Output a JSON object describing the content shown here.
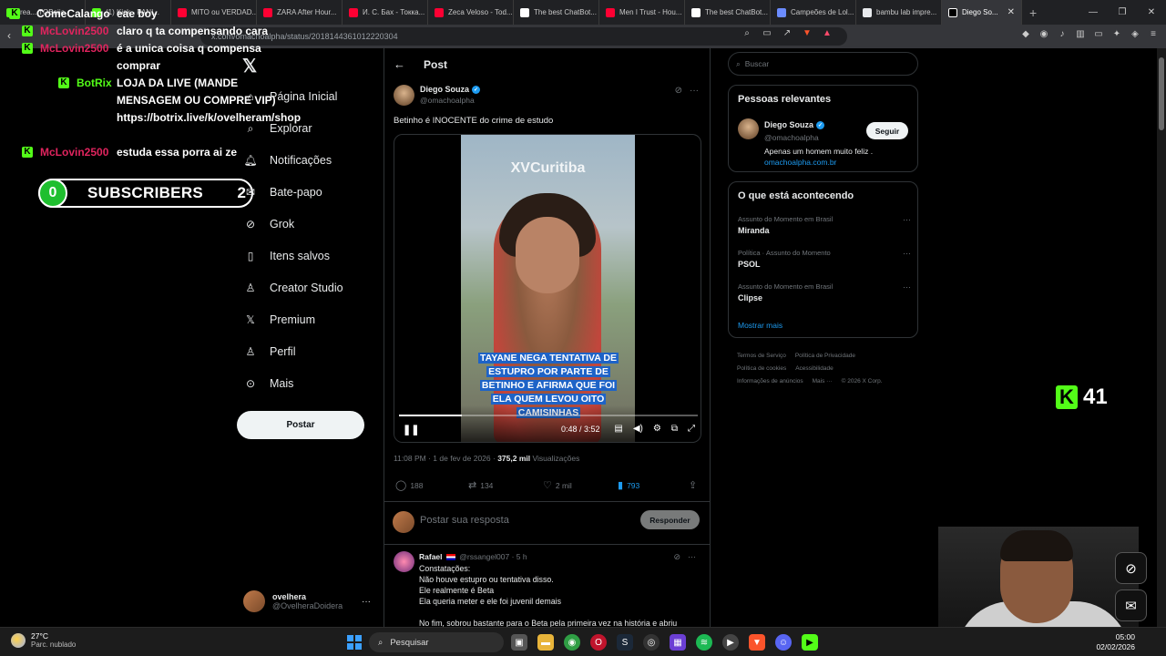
{
  "browser": {
    "tabs": [
      {
        "label": "rea... TOBeija",
        "color": "#53fc18"
      },
      {
        "label": "(1) Kick - PANI...",
        "color": "#53fc18"
      },
      {
        "label": "MITO ou VERDAD...",
        "color": "#ff0033"
      },
      {
        "label": "ZARA After Hour...",
        "color": "#ff0033"
      },
      {
        "label": "И. С. Бах - Токка...",
        "color": "#ff0033"
      },
      {
        "label": "Zeca Veloso - Tod...",
        "color": "#ff0033"
      },
      {
        "label": "The best ChatBot...",
        "color": "#ffffff"
      },
      {
        "label": "Men I Trust - Hou...",
        "color": "#ff0033"
      },
      {
        "label": "The best ChatBot...",
        "color": "#ffffff"
      },
      {
        "label": "Campeões de Lol...",
        "color": "#6b8cff"
      },
      {
        "label": "bambu lab impre...",
        "color": "#e8eaed"
      }
    ],
    "active_tab": {
      "label": "Diego So..."
    },
    "url": "x.com/omachoalpha/status/2018144361012220304"
  },
  "chat": {
    "messages": [
      {
        "user": "ComeCalango",
        "user_color": "#ffffff",
        "text": "eae boy"
      },
      {
        "user": "McLovin2500",
        "user_color": "#e0245e",
        "text": "claro q ta compensando cara"
      },
      {
        "user": "McLovin2500",
        "user_color": "#e0245e",
        "text": "é a unica coisa q compensa comprar"
      },
      {
        "user": "BotRix",
        "user_color": "#53fc18",
        "text": "LOJA DA LIVE (MANDE MENSAGEM OU COMPRE VIP) https://botrix.live/k/ovelheram/shop"
      },
      {
        "user": "McLovin2500",
        "user_color": "#e0245e",
        "text": "estuda essa porra ai ze"
      }
    ],
    "subscribers": {
      "count": "0",
      "label": "SUBSCRIBERS",
      "goal": "2"
    }
  },
  "nav": {
    "items": [
      {
        "label": "Página Inicial",
        "icon": "home-icon"
      },
      {
        "label": "Explorar",
        "icon": "search-icon"
      },
      {
        "label": "Notificações",
        "icon": "bell-icon"
      },
      {
        "label": "Bate-papo",
        "icon": "chat-icon"
      },
      {
        "label": "Grok",
        "icon": "grok-icon"
      },
      {
        "label": "Itens salvos",
        "icon": "bookmark-icon"
      },
      {
        "label": "Creator Studio",
        "icon": "creator-icon"
      },
      {
        "label": "Premium",
        "icon": "x-icon"
      },
      {
        "label": "Perfil",
        "icon": "person-icon"
      },
      {
        "label": "Mais",
        "icon": "more-icon"
      }
    ],
    "post_button": "Postar",
    "account": {
      "name": "ovelhera",
      "handle": "@OvelheraDoidera"
    }
  },
  "post": {
    "header": "Post",
    "author_name": "Diego Souza",
    "author_handle": "@omachoalpha",
    "text": "Betinho é INOCENTE do crime de estudo",
    "video": {
      "watermark": "XVCuritiba",
      "caption": "TAYANE NEGA TENTATIVA DE ESTUPRO POR PARTE DE BETINHO E AFIRMA QUE FOI ELA QUEM LEVOU OITO CAMISINHAS",
      "time": "0:48 / 3:52",
      "progress": 0.21
    },
    "timestamp": "11:08 PM · 1 de fev de 2026 · ",
    "views": "375,2 mil",
    "views_label": "Visualizações",
    "stats": {
      "replies": "188",
      "reposts": "134",
      "likes": "2 mil",
      "bookmarks": "793"
    },
    "reply_placeholder": "Postar sua resposta",
    "reply_button": "Responder"
  },
  "reply": {
    "name": "Rafael",
    "handle": "@rssangel007 · 5 h",
    "lines": [
      "Constatações:",
      "Não houve estupro ou tentativa disso.",
      "Ele realmente é Beta",
      "Ela queria meter e ele foi juvenil demais",
      "",
      "No fim, sobrou bastante para o Beta pela primeira vez na história e abriu"
    ]
  },
  "sidebar": {
    "search_placeholder": "Buscar",
    "relevant_title": "Pessoas relevantes",
    "relevant": {
      "name": "Diego Souza",
      "handle": "@omachoalpha",
      "bio": "Apenas um homem muito feliz .",
      "link": "omachoalpha.com.br",
      "follow": "Seguir"
    },
    "trending_title": "O que está acontecendo",
    "trends": [
      {
        "context": "Assunto do Momento em Brasil",
        "name": "Miranda"
      },
      {
        "context": "Política · Assunto do Momento",
        "name": "PSOL"
      },
      {
        "context": "Assunto do Momento em Brasil",
        "name": "Clipse"
      }
    ],
    "show_more": "Mostrar mais",
    "footer": [
      "Termos de Serviço",
      "Política de Privacidade",
      "Política de cookies",
      "Acessibilidade",
      "Informações de anúncios",
      "Mais ···",
      "© 2026 X Corp."
    ]
  },
  "overlay": {
    "kick_count": "41"
  },
  "taskbar": {
    "weather_temp": "27°C",
    "weather_desc": "Parc. nublado",
    "search": "Pesquisar",
    "time": "05:00",
    "date": "02/02/2026"
  }
}
